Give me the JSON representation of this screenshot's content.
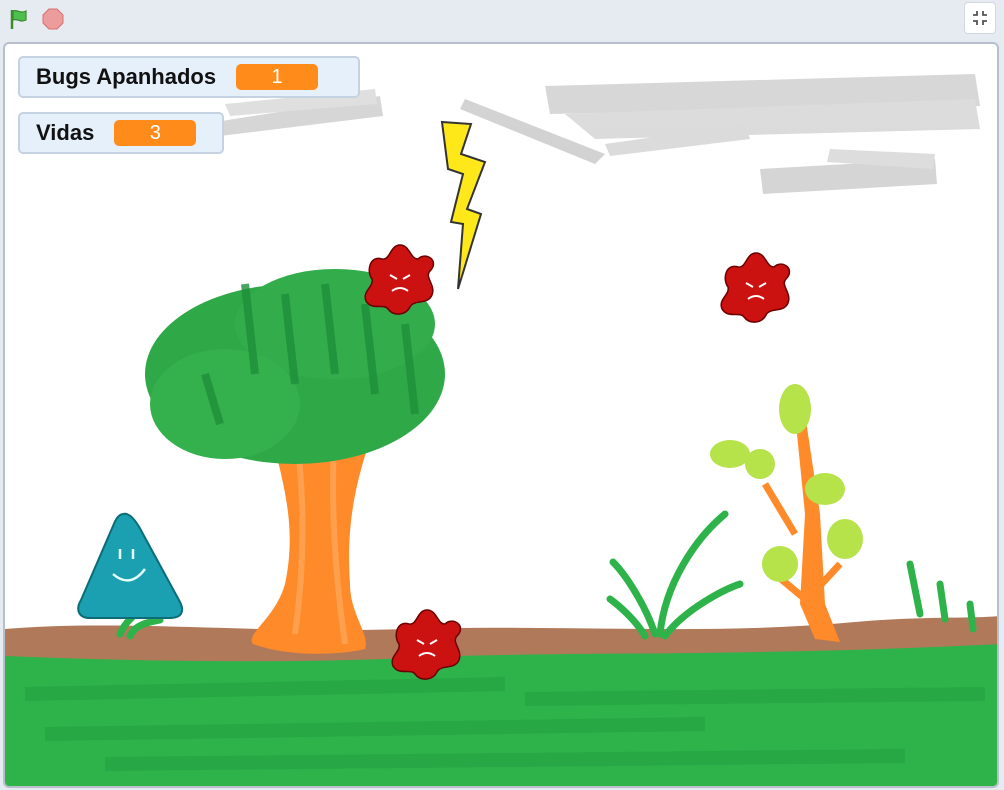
{
  "toolbar": {
    "green_flag_icon": "green-flag-icon",
    "stop_icon": "stop-sign-icon",
    "fullscreen_icon": "exit-fullscreen-icon"
  },
  "monitors": {
    "bugs": {
      "label": "Bugs Apanhados",
      "value": "1"
    },
    "lives": {
      "label": "Vidas",
      "value": "3"
    }
  },
  "colors": {
    "monitor_value": "#ff8c1a",
    "bug": "#cc1111",
    "player": "#1aa0b0",
    "lightning": "#ffe81a",
    "grass": "#2db34a",
    "ground": "#b07050",
    "trunk": "#ff8a2a"
  }
}
